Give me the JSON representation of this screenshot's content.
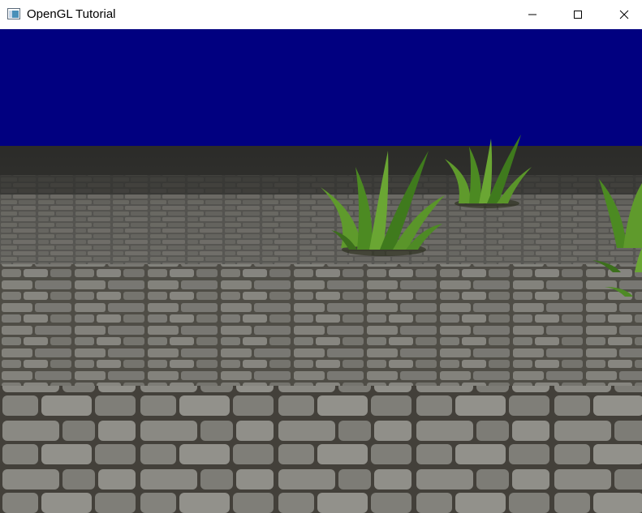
{
  "window": {
    "title": "OpenGL Tutorial",
    "app_icon": "window-app-icon",
    "controls": {
      "minimize_icon": "minimize-icon",
      "maximize_icon": "maximize-icon",
      "close_icon": "close-icon"
    }
  },
  "scene": {
    "sky_color": "#010080",
    "ground_texture": "cobblestone",
    "ground_color": "#6f6f6f",
    "grass_color": "#4c8a22",
    "objects": [
      "grass-patch",
      "grass-patch",
      "grass-patch"
    ]
  }
}
